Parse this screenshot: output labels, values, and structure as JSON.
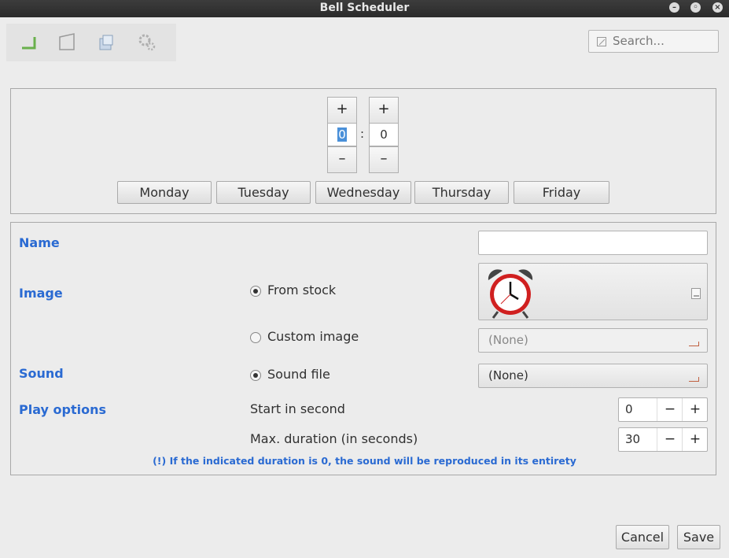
{
  "window": {
    "title": "Bell Scheduler"
  },
  "search": {
    "placeholder": "Search..."
  },
  "time": {
    "hours": "0",
    "minutes": "0",
    "separator": ":",
    "plus": "+",
    "minus": "–"
  },
  "days": [
    "Monday",
    "Tuesday",
    "Wednesday",
    "Thursday",
    "Friday"
  ],
  "form": {
    "name_label": "Name",
    "image_label": "Image",
    "from_stock": "From stock",
    "custom_image": "Custom image",
    "custom_image_value": "(None)",
    "sound_label": "Sound",
    "sound_file": "Sound file",
    "sound_value": "(None)",
    "play_label": "Play options",
    "start_label": "Start in second",
    "start_value": "0",
    "duration_label": "Max. duration (in seconds)",
    "duration_value": "30",
    "minus": "−",
    "plus": "+",
    "note": "(!) If the indicated duration is 0, the sound will be reproduced in its entirety"
  },
  "buttons": {
    "cancel": "Cancel",
    "save": "Save"
  },
  "colors": {
    "accent": "#2a6ad2",
    "clock_red": "#d02020"
  }
}
